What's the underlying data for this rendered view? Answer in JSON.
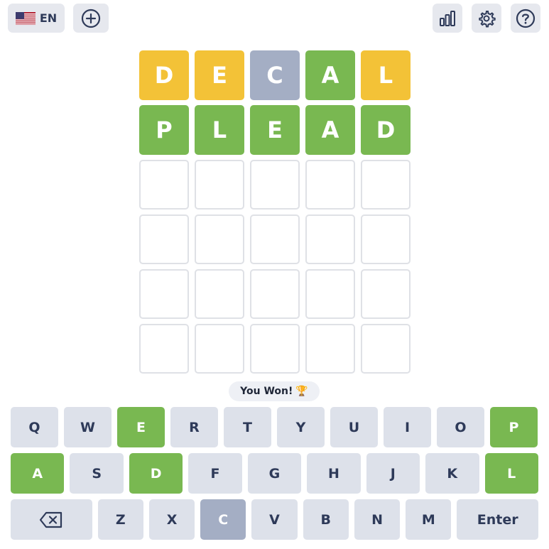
{
  "header": {
    "language_label": "EN",
    "icons": {
      "flag": "us-flag-icon",
      "add": "plus-circle-icon",
      "stats": "bar-chart-icon",
      "settings": "gear-icon",
      "help": "question-circle-icon"
    }
  },
  "board": {
    "rows": [
      [
        {
          "letter": "D",
          "state": "present"
        },
        {
          "letter": "E",
          "state": "present"
        },
        {
          "letter": "C",
          "state": "absent"
        },
        {
          "letter": "A",
          "state": "correct"
        },
        {
          "letter": "L",
          "state": "present"
        }
      ],
      [
        {
          "letter": "P",
          "state": "correct"
        },
        {
          "letter": "L",
          "state": "correct"
        },
        {
          "letter": "E",
          "state": "correct"
        },
        {
          "letter": "A",
          "state": "correct"
        },
        {
          "letter": "D",
          "state": "correct"
        }
      ],
      [
        {
          "letter": "",
          "state": "empty"
        },
        {
          "letter": "",
          "state": "empty"
        },
        {
          "letter": "",
          "state": "empty"
        },
        {
          "letter": "",
          "state": "empty"
        },
        {
          "letter": "",
          "state": "empty"
        }
      ],
      [
        {
          "letter": "",
          "state": "empty"
        },
        {
          "letter": "",
          "state": "empty"
        },
        {
          "letter": "",
          "state": "empty"
        },
        {
          "letter": "",
          "state": "empty"
        },
        {
          "letter": "",
          "state": "empty"
        }
      ],
      [
        {
          "letter": "",
          "state": "empty"
        },
        {
          "letter": "",
          "state": "empty"
        },
        {
          "letter": "",
          "state": "empty"
        },
        {
          "letter": "",
          "state": "empty"
        },
        {
          "letter": "",
          "state": "empty"
        }
      ],
      [
        {
          "letter": "",
          "state": "empty"
        },
        {
          "letter": "",
          "state": "empty"
        },
        {
          "letter": "",
          "state": "empty"
        },
        {
          "letter": "",
          "state": "empty"
        },
        {
          "letter": "",
          "state": "empty"
        }
      ]
    ]
  },
  "toast": {
    "text": "You Won!",
    "icon": "trophy-icon",
    "emoji": "🏆"
  },
  "keyboard": {
    "rows": [
      [
        {
          "label": "Q",
          "state": "default"
        },
        {
          "label": "W",
          "state": "default"
        },
        {
          "label": "E",
          "state": "correct"
        },
        {
          "label": "R",
          "state": "default"
        },
        {
          "label": "T",
          "state": "default"
        },
        {
          "label": "Y",
          "state": "default"
        },
        {
          "label": "U",
          "state": "default"
        },
        {
          "label": "I",
          "state": "default"
        },
        {
          "label": "O",
          "state": "default"
        },
        {
          "label": "P",
          "state": "correct"
        }
      ],
      [
        {
          "label": "A",
          "state": "correct"
        },
        {
          "label": "S",
          "state": "default"
        },
        {
          "label": "D",
          "state": "correct"
        },
        {
          "label": "F",
          "state": "default"
        },
        {
          "label": "G",
          "state": "default"
        },
        {
          "label": "H",
          "state": "default"
        },
        {
          "label": "J",
          "state": "default"
        },
        {
          "label": "K",
          "state": "default"
        },
        {
          "label": "L",
          "state": "correct"
        }
      ],
      [
        {
          "label": "",
          "icon": "backspace-icon",
          "state": "default",
          "wide": true
        },
        {
          "label": "Z",
          "state": "default"
        },
        {
          "label": "X",
          "state": "default"
        },
        {
          "label": "C",
          "state": "absent"
        },
        {
          "label": "V",
          "state": "default"
        },
        {
          "label": "B",
          "state": "default"
        },
        {
          "label": "N",
          "state": "default"
        },
        {
          "label": "M",
          "state": "default"
        },
        {
          "label": "Enter",
          "state": "default",
          "wide": true
        }
      ]
    ]
  },
  "colors": {
    "correct": "#79b851",
    "present": "#f3c237",
    "absent": "#a4aec4",
    "key_default": "#dde1ea"
  }
}
